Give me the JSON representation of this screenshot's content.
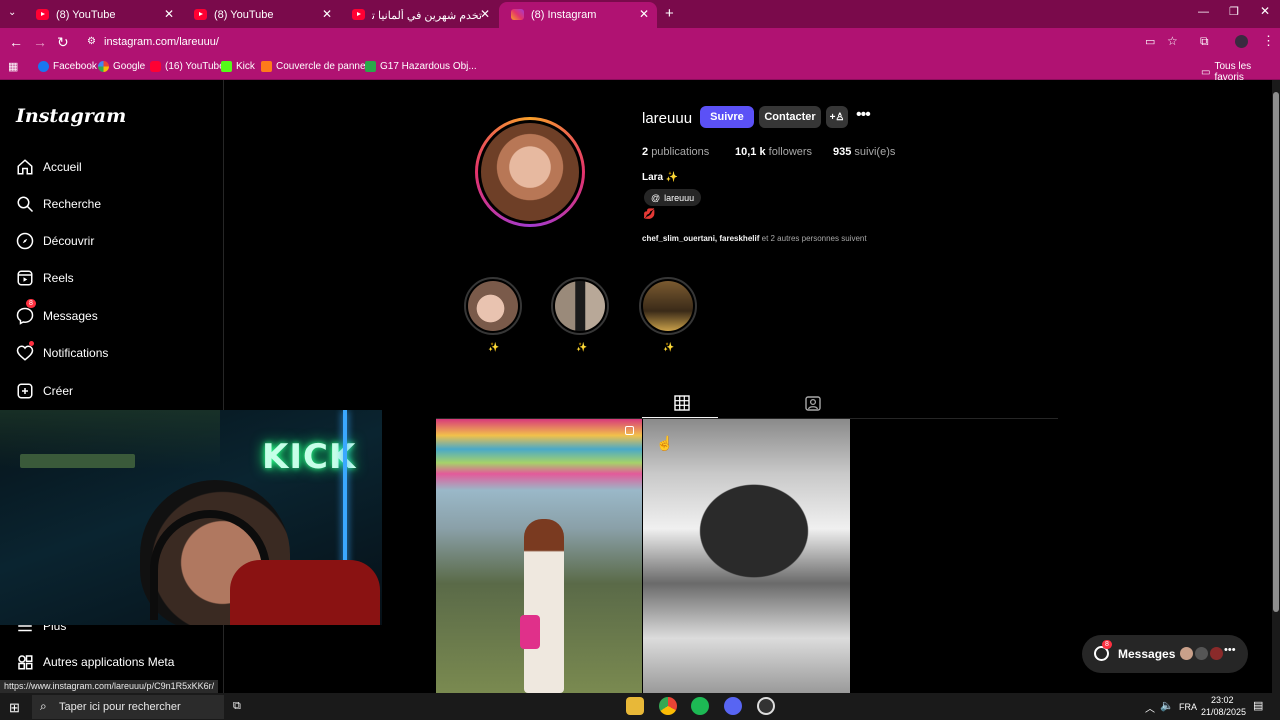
{
  "browser": {
    "tabs": [
      {
        "title": "(8) YouTube",
        "close": "✕"
      },
      {
        "title": "(8) YouTube",
        "close": "✕"
      },
      {
        "title": "تخدم شهرين في ألمانيا تشري بيت...",
        "close": "✕"
      },
      {
        "title": "(8) Instagram",
        "close": "✕"
      }
    ],
    "new_tab": "+",
    "url": "instagram.com/lareuuu/",
    "bookmarks": [
      "Facebook",
      "Google",
      "(16) YouTube",
      "Kick",
      "Couvercle de panne...",
      "G17 Hazardous Obj..."
    ],
    "all_bookmarks": "Tous les favoris"
  },
  "sidebar": {
    "logo": "Instagram",
    "items": [
      {
        "label": "Accueil"
      },
      {
        "label": "Recherche"
      },
      {
        "label": "Découvrir"
      },
      {
        "label": "Reels"
      },
      {
        "label": "Messages",
        "badge": "8"
      },
      {
        "label": "Notifications"
      },
      {
        "label": "Créer"
      },
      {
        "label": "Plus"
      },
      {
        "label": "Autres applications Meta"
      }
    ]
  },
  "profile": {
    "username": "lareuuu",
    "follow": "Suivre",
    "contact": "Contacter",
    "stats": [
      {
        "num": "2",
        "label": "publications"
      },
      {
        "num": "10,1 k",
        "label": "followers"
      },
      {
        "num": "935",
        "label": "suivi(e)s"
      }
    ],
    "name": "Lara ✨",
    "threads_handle": "lareuuu",
    "emoji": "💋",
    "followed_by_names": "chef_slim_ouertani, fareskhelif",
    "followed_by_rest": " et 2 autres personnes suivent",
    "highlights": [
      "✨",
      "✨",
      "✨"
    ]
  },
  "webcam": {
    "sign": "KICK"
  },
  "messages_pill": {
    "label": "Messages",
    "badge": "8"
  },
  "status_url": "https://www.instagram.com/lareuuu/p/C9n1R5xKK6r/",
  "taskbar": {
    "search_placeholder": "Taper ici pour rechercher",
    "lang": "FRA",
    "time": "23:02",
    "date": "21/08/2025"
  },
  "colors": {
    "accent": "#7a0a4b",
    "follow": "#5b51f6",
    "chrome": "#b01272"
  }
}
